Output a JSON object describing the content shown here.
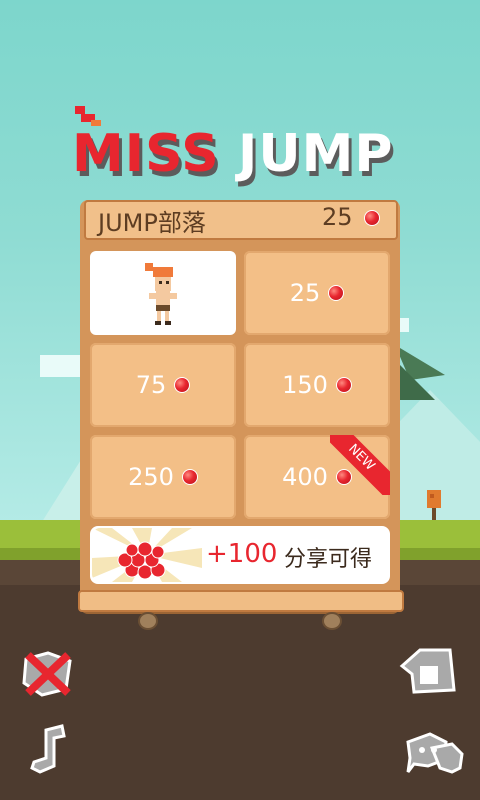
{
  "title": {
    "word1": "MISS",
    "word2": "JUMP"
  },
  "panel": {
    "header_title": "JUMP部落",
    "coin_count": "25"
  },
  "grid": [
    {
      "price": "",
      "selected": true
    },
    {
      "price": "25"
    },
    {
      "price": "75"
    },
    {
      "price": "150"
    },
    {
      "price": "250"
    },
    {
      "price": "400",
      "badge": "NEW"
    }
  ],
  "share": {
    "bonus": "+100",
    "label": "分享可得"
  },
  "colors": {
    "accent": "#e8262f",
    "panel": "#d4955a",
    "cell": "#f3bf87"
  },
  "icons": {
    "bottom_left_top": "no-ads-icon",
    "bottom_left_bottom": "music-icon",
    "bottom_right_top": "leaderboard-icon",
    "bottom_right_bottom": "chat-icon"
  }
}
